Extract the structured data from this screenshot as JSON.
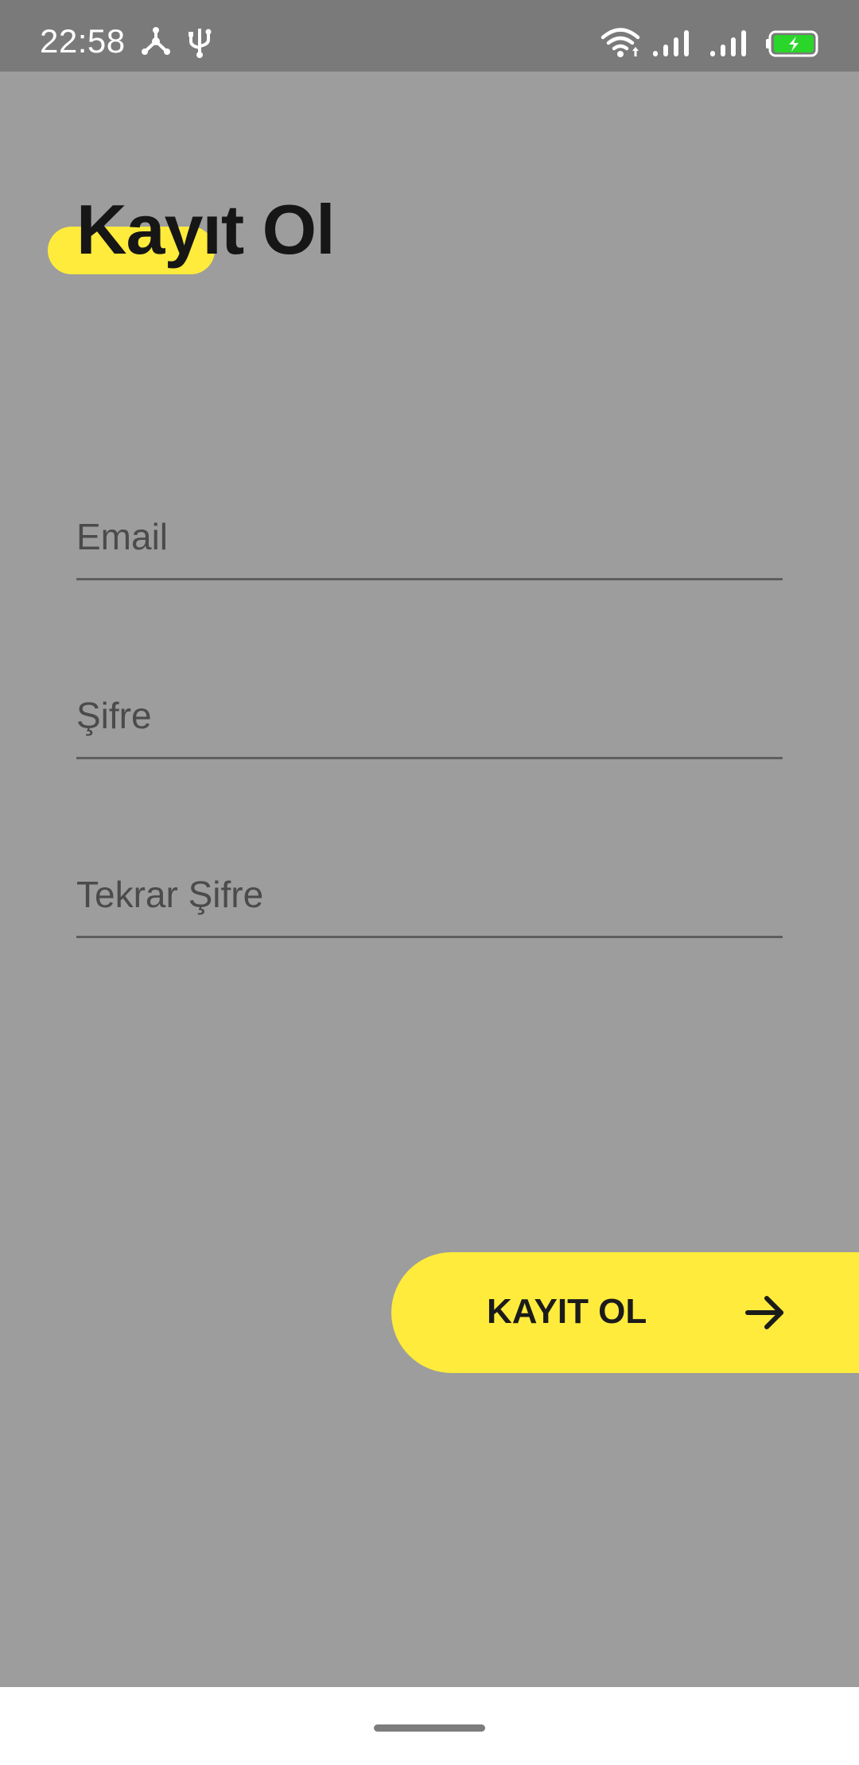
{
  "status_bar": {
    "time": "22:58",
    "icons": [
      "share-icon",
      "usb-icon",
      "wifi-icon",
      "signal-icon",
      "signal-icon",
      "battery-charging-icon"
    ],
    "battery_color": "#2bd62b"
  },
  "header": {
    "title": "Kayıt Ol",
    "accent_color": "#ffeb3b"
  },
  "form": {
    "email_placeholder": "Email",
    "password_placeholder": "Şifre",
    "password_repeat_placeholder": "Tekrar Şifre"
  },
  "submit": {
    "label": "KAYIT OL",
    "icon": "arrow-right-icon"
  },
  "colors": {
    "background": "#9d9d9d",
    "status_bar": "#7a7a7a",
    "accent": "#ffeb3b",
    "text": "#161616"
  }
}
